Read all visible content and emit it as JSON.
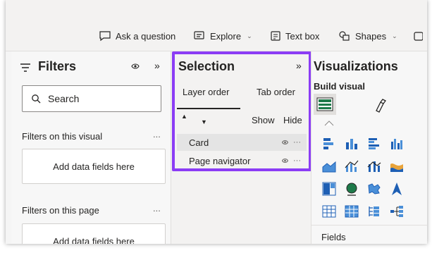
{
  "ribbon": {
    "ask_question": "Ask a question",
    "explore": "Explore",
    "text_box": "Text box",
    "shapes": "Shapes"
  },
  "filters": {
    "title": "Filters",
    "search_placeholder": "Search",
    "section_visual": "Filters on this visual",
    "section_page": "Filters on this page",
    "add_fields": "Add data fields here",
    "dots": "..."
  },
  "selection": {
    "title": "Selection",
    "tab_layer": "Layer order",
    "tab_tab": "Tab order",
    "show": "Show",
    "hide": "Hide",
    "layers": [
      {
        "name": "Card"
      },
      {
        "name": "Page navigator"
      }
    ],
    "highlight_color": "#8b3cf5"
  },
  "visualizations": {
    "title": "Visualizations",
    "build_visual": "Build visual",
    "fields": "Fields",
    "icons": [
      "stacked-bar-icon",
      "stacked-column-icon",
      "clustered-bar-icon",
      "clustered-column-icon",
      "area-chart-icon",
      "line-column-icon",
      "ribbon-chart-icon",
      "waterfall-icon",
      "treemap-icon",
      "globe-map-icon",
      "filled-map-icon",
      "azure-map-icon",
      "table-icon",
      "matrix-icon",
      "slicer-icon",
      "decomposition-tree-icon"
    ]
  }
}
